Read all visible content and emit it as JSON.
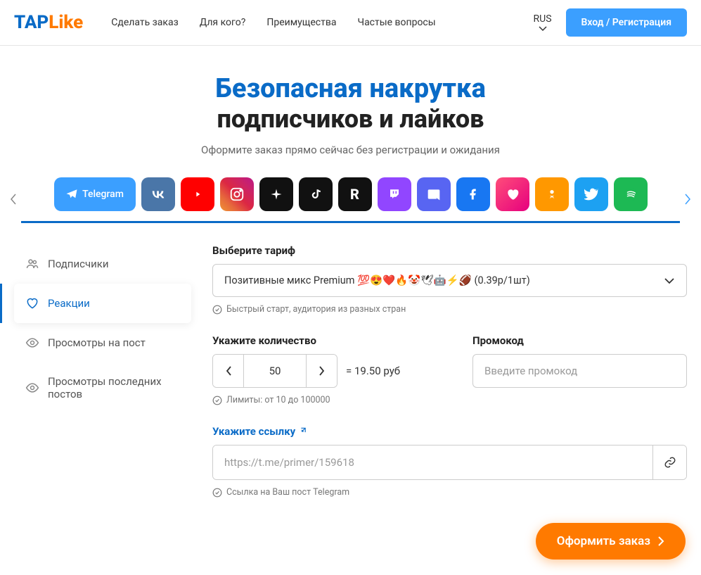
{
  "logo": {
    "tap": "TAP",
    "like": "Like"
  },
  "nav": [
    "Сделать заказ",
    "Для кого?",
    "Преимущества",
    "Частые вопросы"
  ],
  "lang": "RUS",
  "login": "Вход / Регистрация",
  "hero": {
    "title": "Безопасная накрутка",
    "subtitle": "подписчиков и лайков",
    "desc": "Оформите заказ прямо сейчас без регистрации и ожидания"
  },
  "platforms": {
    "active_label": "Telegram"
  },
  "sidebar": [
    {
      "label": "Подписчики",
      "active": false
    },
    {
      "label": "Реакции",
      "active": true
    },
    {
      "label": "Просмотры на пост",
      "active": false
    },
    {
      "label": "Просмотры последних постов",
      "active": false
    }
  ],
  "tariff": {
    "label": "Выберите тариф",
    "selected": "Позитивные микс Premium 💯😍❤️🔥🤡🕊🤖⚡️🏈 (0.39р/1шт)",
    "hint": "Быстрый старт, аудитория из разных стран"
  },
  "quantity": {
    "label": "Укажите количество",
    "value": "50",
    "price": "= 19.50 руб",
    "limits": "Лимиты: от 10 до 100000"
  },
  "promo": {
    "label": "Промокод",
    "placeholder": "Введите промокод"
  },
  "link": {
    "label": "Укажите ссылку",
    "placeholder": "https://t.me/primer/159618",
    "hint": "Ссылка на Ваш пост Telegram"
  },
  "submit": "Оформить заказ"
}
